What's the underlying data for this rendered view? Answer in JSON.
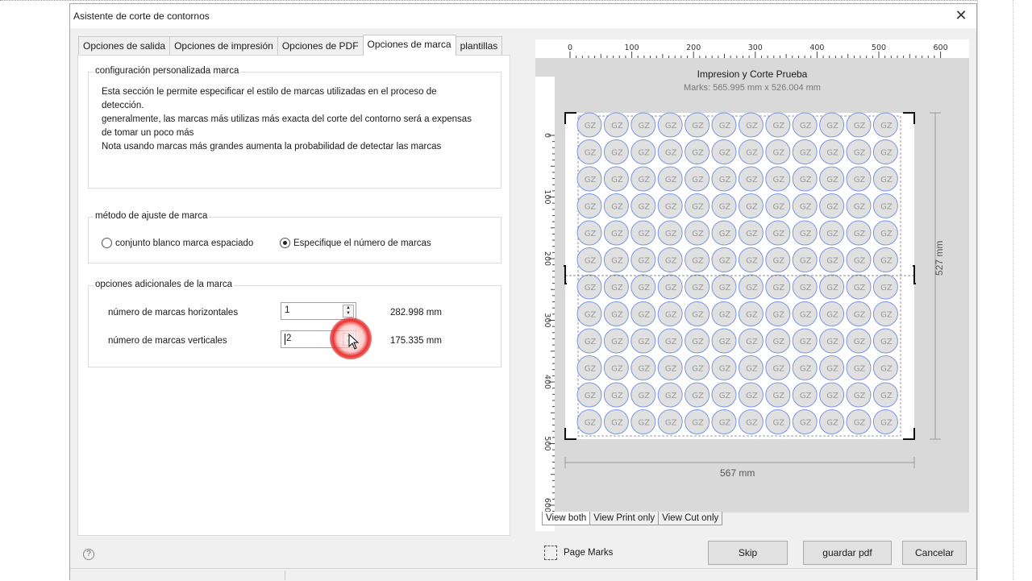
{
  "dialog": {
    "title": "Asistente de corte de contornos"
  },
  "tabs": [
    {
      "label": "Opciones de salida"
    },
    {
      "label": "Opciones de impresión"
    },
    {
      "label": "Opciones de PDF"
    },
    {
      "label": "Opciones de marca"
    },
    {
      "label": "plantillas"
    }
  ],
  "active_tab": "Opciones de marca",
  "custom_group": {
    "title": "configuración personalizada marca",
    "lines": [
      "Esta sección le permite especificar el estilo de marcas utilizadas en el proceso de",
      "detección.",
      "generalmente, las marcas más utilizas más exacta del corte del contorno será a expensas",
      "de tomar un poco más",
      "Nota usando marcas más grandes aumenta la probabilidad de detectar las marcas"
    ]
  },
  "method_group": {
    "title": "método de ajuste de marca",
    "option1": "conjunto blanco marca espaciado",
    "option2": "Especifique el número de marcas",
    "selected": "Especifique el número de marcas"
  },
  "additional_group": {
    "title": "opciones adicionales de la marca",
    "horizontal_label": "número de marcas horizontales",
    "horizontal_value": "1",
    "horizontal_mm": "282.998 mm",
    "vertical_label": "número de marcas verticales",
    "vertical_value": "2",
    "vertical_mm": "175.335 mm"
  },
  "preview": {
    "title": "Impresion y Corte Prueba",
    "subtitle": "Marks: 565.995 mm x 526.004 mm",
    "width_label": "567 mm",
    "height_label": "527 mm",
    "ruler_top": [
      "0",
      "100",
      "200",
      "300",
      "400",
      "500",
      "600"
    ],
    "ruler_left": [
      "0",
      "100",
      "200",
      "300",
      "400",
      "500",
      "600"
    ],
    "sticker_text": "GZ",
    "grid_cols": 12,
    "grid_rows": 12
  },
  "view_tabs": [
    "View both",
    "View Print only",
    "View Cut only"
  ],
  "page_marks_label": "Page Marks",
  "buttons": {
    "skip": "Skip",
    "save_pdf": "guardar pdf",
    "cancel": "Cancelar"
  },
  "colors": {
    "accent_red": "#e53030",
    "sticker_border": "#7b96e0",
    "sticker_fill": "#e0e0e0"
  }
}
